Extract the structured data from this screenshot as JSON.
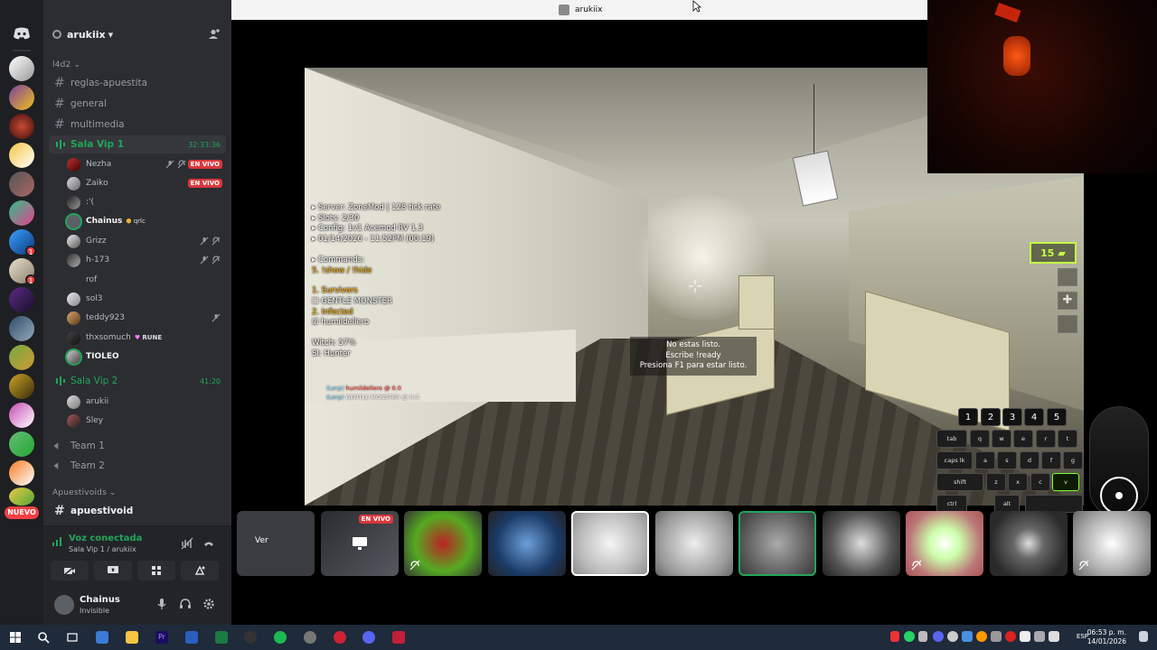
{
  "window": {
    "title": "arukiix"
  },
  "server": {
    "name": "arukiix"
  },
  "rail": {
    "new_label": "NUEVO",
    "badges": [
      "1",
      "1"
    ]
  },
  "channels": {
    "category1": "l4d2",
    "text": [
      "reglas-apuestita",
      "general",
      "multimedia"
    ],
    "vip1": {
      "name": "Sala Vip 1",
      "time": "32:33:36"
    },
    "vip1_members": [
      {
        "name": "Nezha",
        "live": "EN VIVO"
      },
      {
        "name": "Zaiko",
        "live": "EN VIVO"
      },
      {
        "name": ":'("
      },
      {
        "name": "Chainus",
        "tag": "qrlc"
      },
      {
        "name": "Grizz"
      },
      {
        "name": "h-173"
      },
      {
        "name": "rof"
      },
      {
        "name": "sol3"
      },
      {
        "name": "teddy923"
      },
      {
        "name": "thxsomuch",
        "tag": "RUNE"
      },
      {
        "name": "TIOLEO"
      }
    ],
    "vip2": {
      "name": "Sala Vip 2",
      "time": "41:20"
    },
    "vip2_members": [
      "arukii",
      "Sley"
    ],
    "team1": "Team 1",
    "team2": "Team 2",
    "category2": "Apuestivoids",
    "apuestivoid": "apuestivoid"
  },
  "voice_panel": {
    "status": "Voz conectada",
    "location": "Sala Vip 1 / arukiix"
  },
  "user": {
    "name": "Chainus",
    "status": "Invisible"
  },
  "game_hud": {
    "server": "Server: ZoneMod | 128 tick rate",
    "slots": "Slots: 2/30",
    "config": "Config: 1v1 Acemod RV 1.3",
    "time": "01/14/2026 - 11:52PM (00:19)",
    "commands_title": "Commands:",
    "commands": "5. !show / !hide",
    "survivors": "1. Survivors",
    "survivor_name": "GENTLE MONSTER",
    "infected": "2. Infected",
    "infected_name": "humildellero",
    "witch": "Witch: 57%",
    "si": "SI: Hunter",
    "chat1_prefix": "(Lerp)",
    "chat1_name": "humildellero",
    "chat1_value": "@ 0.0",
    "chat2_prefix": "(Lerp)",
    "chat2_name": "GENTLE MONSTER",
    "chat2_value": "@ 0.0",
    "msg1": "No estas listo.",
    "msg2": "Escribe !ready",
    "msg3": "Presiona F1 para estar listo.",
    "ammo": "15"
  },
  "keyboard": {
    "numbers": [
      "1",
      "2",
      "3",
      "4",
      "5"
    ],
    "row1": [
      "tab",
      "q",
      "w",
      "e",
      "r",
      "t"
    ],
    "row2": [
      "caps lk",
      "a",
      "s",
      "d",
      "f",
      "g"
    ],
    "row3": [
      "shift",
      "z",
      "x",
      "c",
      "v"
    ],
    "row4": [
      "ctrl",
      "alt"
    ]
  },
  "strip": {
    "ver_label": "Ver",
    "live_label": "EN VIVO"
  },
  "taskbar": {
    "lang": "ESP",
    "time": "06:53 p. m.",
    "date": "14/01/2026"
  },
  "colors": {
    "discord_bg": "#2b2d31",
    "green": "#23a55a",
    "live_red": "#da373c",
    "hud_green": "#c3ff45"
  }
}
